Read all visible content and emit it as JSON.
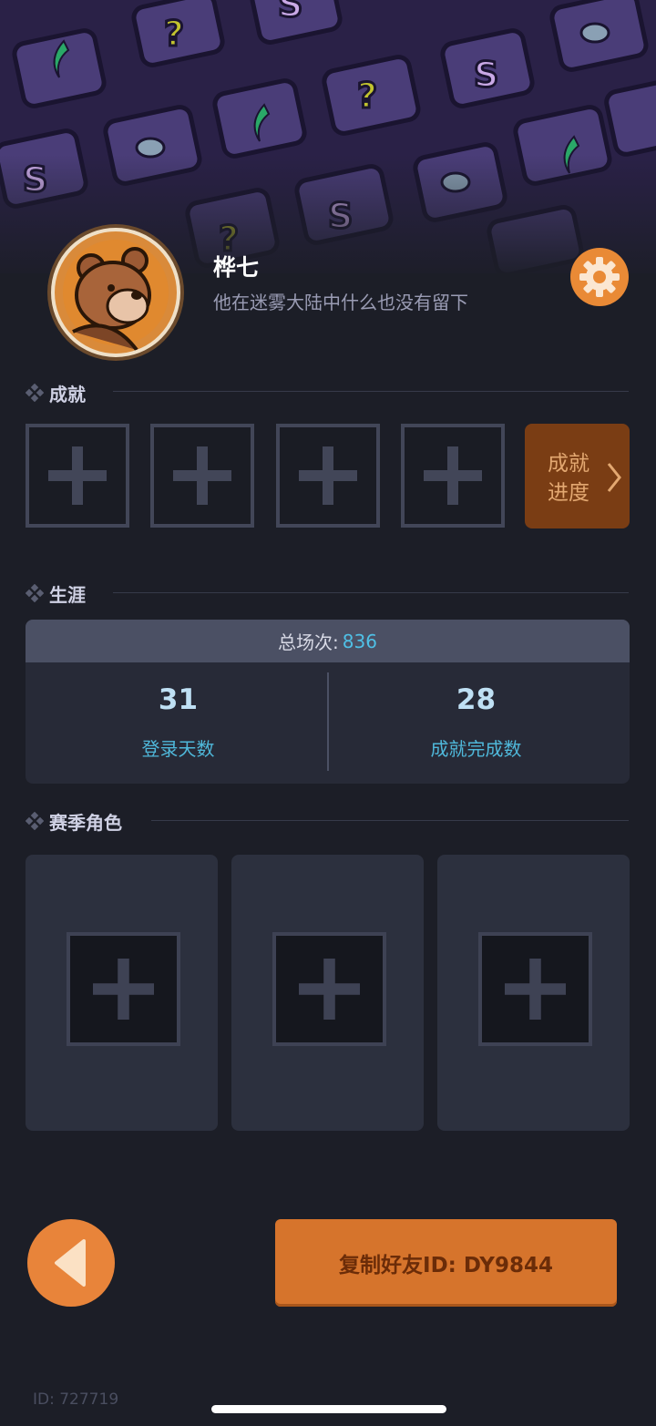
{
  "profile": {
    "name": "桦七",
    "bio": "他在迷雾大陆中什么也没有留下",
    "avatar_icon": "bear-avatar-icon",
    "settings_icon": "gear-icon"
  },
  "achievements": {
    "title": "成就",
    "slots": [
      "+",
      "+",
      "+",
      "+"
    ],
    "progress_label": "成就\n进度",
    "progress_icon": "chevron-right-icon"
  },
  "career": {
    "title": "生涯",
    "total_label": "总场次:",
    "total_value": "836",
    "stats": [
      {
        "value": "31",
        "label": "登录天数"
      },
      {
        "value": "28",
        "label": "成就完成数"
      }
    ]
  },
  "season_characters": {
    "title": "赛季角色",
    "slots": [
      "+",
      "+",
      "+"
    ]
  },
  "footer": {
    "back_icon": "back-arrow-icon",
    "copy_button_label": "复制好友ID: DY9844",
    "player_id": "ID: 727719"
  },
  "colors": {
    "accent_orange": "#e8843a",
    "stat_blue": "#4fc0e6",
    "background": "#1c1e27",
    "banner": "#2a2147"
  }
}
